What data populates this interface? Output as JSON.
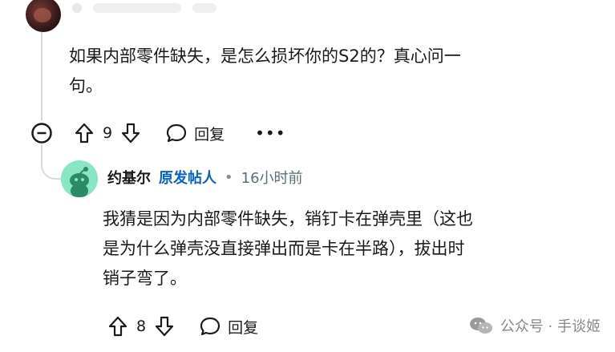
{
  "comment": {
    "text_line1": "如果内部零件缺失，是怎么损坏你的S2的？真心问一",
    "text_line2": "句。",
    "upvotes": "9",
    "reply_label": "回复",
    "more_label": "•••"
  },
  "reply": {
    "author": "约基尔",
    "op_badge": "原发帖人",
    "separator": "•",
    "time": "16小时前",
    "text_line1": "我猜是因为内部零件缺失，销钉卡在弹壳里（这也",
    "text_line2": "是为什么弹壳没直接弹出而是卡在半路），拔出时",
    "text_line3": "销子弯了。",
    "upvotes": "8",
    "reply_label": "回复"
  },
  "watermark": {
    "text": "公众号 · 手谈姬"
  },
  "icons": {
    "collapse": "minus-circle-icon",
    "upvote": "arrow-up-icon",
    "downvote": "arrow-down-icon",
    "reply": "speech-bubble-icon",
    "avatar": "reddit-snoo-icon",
    "watermark": "wechat-icon"
  }
}
